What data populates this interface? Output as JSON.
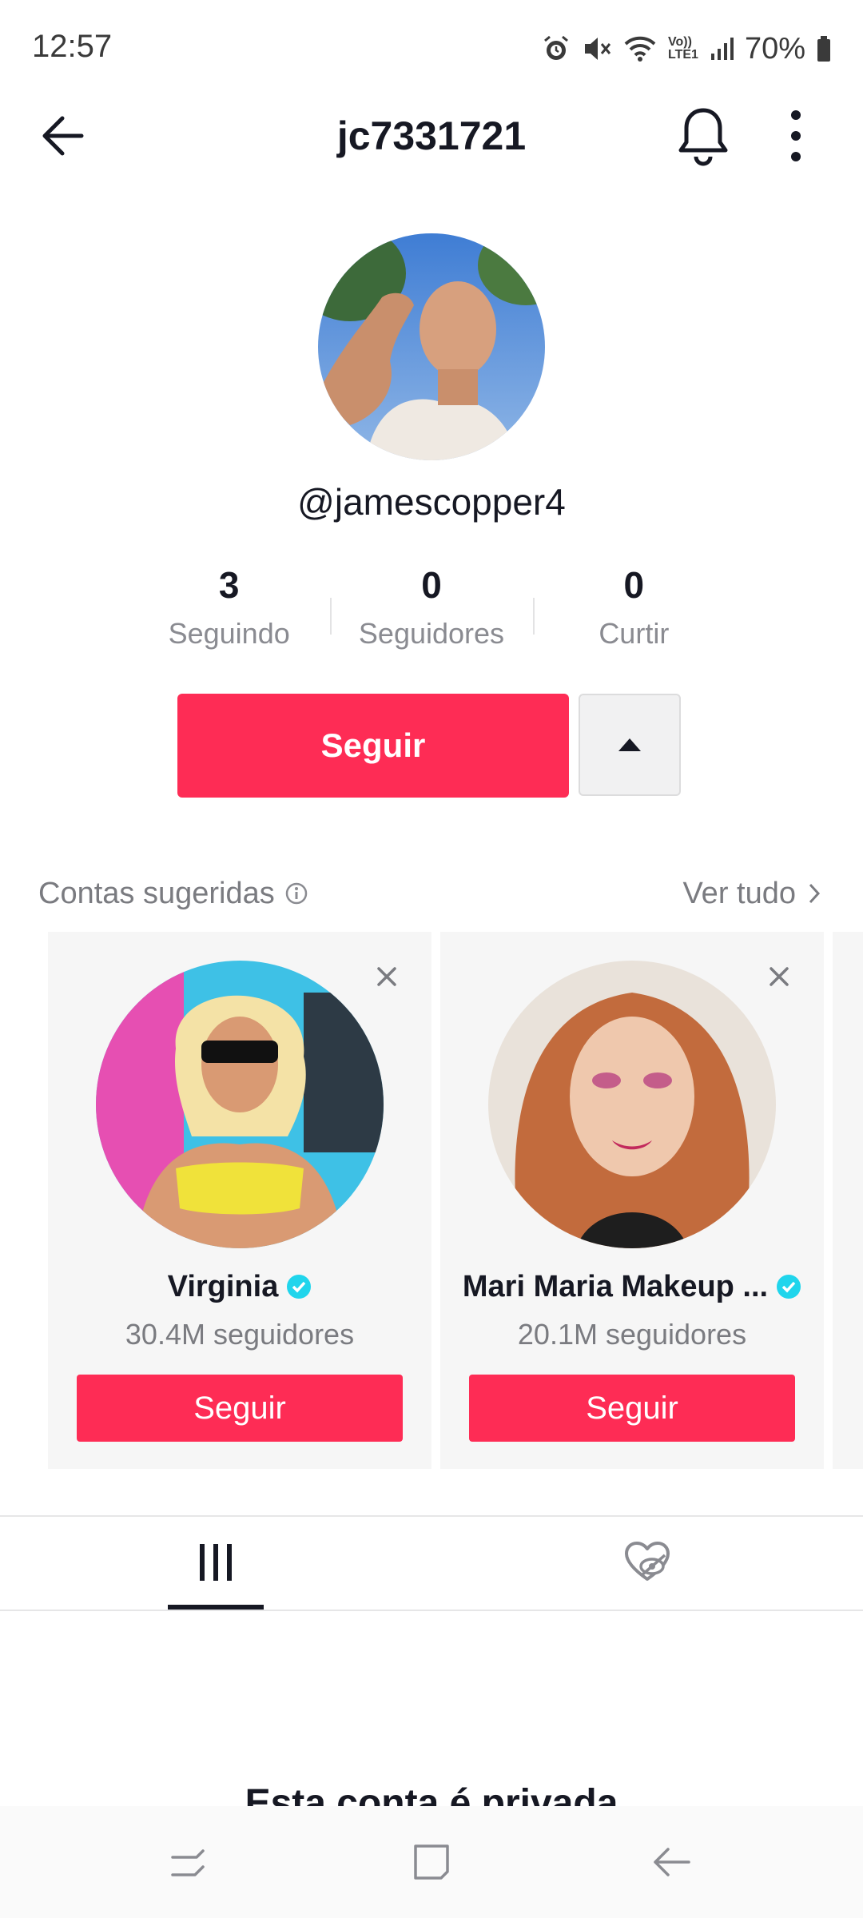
{
  "status_bar": {
    "time": "12:57",
    "battery": "70%",
    "icons": [
      "alarm-icon",
      "mute-icon",
      "wifi-icon",
      "volte-icon",
      "signal-icon",
      "battery-icon"
    ],
    "volte_label": "Vo))\nLTE1"
  },
  "header": {
    "title": "jc7331721",
    "back_icon": "arrow-left-icon",
    "bell_icon": "bell-icon",
    "more_icon": "more-vertical-icon"
  },
  "profile": {
    "handle": "@jamescopper4",
    "stats": [
      {
        "value": "3",
        "label": "Seguindo"
      },
      {
        "value": "0",
        "label": "Seguidores"
      },
      {
        "value": "0",
        "label": "Curtir"
      }
    ],
    "follow_label": "Seguir"
  },
  "suggested": {
    "title": "Contas sugeridas",
    "see_all": "Ver tudo",
    "cards": [
      {
        "name": "Virginia",
        "followers": "30.4M seguidores",
        "button": "Seguir",
        "verified": true
      },
      {
        "name": "Mari Maria Makeup ...",
        "followers": "20.1M seguidores",
        "button": "Seguir",
        "verified": true
      }
    ]
  },
  "tabs": [
    {
      "icon": "grid-icon",
      "active": true
    },
    {
      "icon": "liked-hidden-icon",
      "active": false
    }
  ],
  "private_message": "Esta conta é privada",
  "colors": {
    "accent": "#fe2c55",
    "verified": "#20d5ec",
    "text": "#161823",
    "muted": "#8a8b91"
  }
}
